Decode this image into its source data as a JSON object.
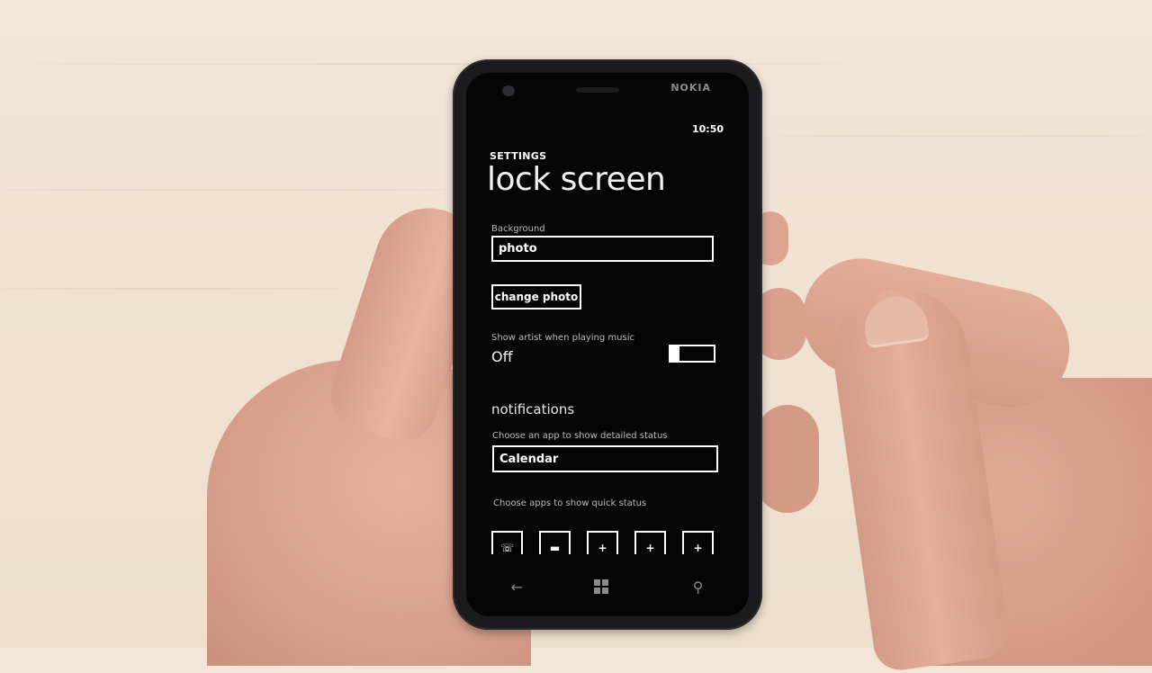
{
  "device": {
    "brand": "NOKIA",
    "status_bar": {
      "time": "10:50"
    }
  },
  "app": {
    "section_title": "SETTINGS",
    "page_title": "lock screen"
  },
  "background": {
    "label": "Background",
    "value": "photo",
    "change_button": "change photo"
  },
  "music_artist": {
    "label": "Show artist when playing music",
    "state": "Off",
    "enabled": false
  },
  "notifications": {
    "header": "notifications",
    "detailed_label": "Choose an app to show detailed status",
    "detailed_value": "Calendar",
    "quick_label": "Choose apps to show quick status",
    "quick_slots": [
      {
        "icon": "phone-icon",
        "glyph": "☏"
      },
      {
        "icon": "message-icon",
        "glyph": "▬"
      },
      {
        "icon": "add-icon",
        "glyph": "+"
      },
      {
        "icon": "add-icon",
        "glyph": "+"
      },
      {
        "icon": "add-icon",
        "glyph": "+"
      }
    ]
  },
  "navbar": {
    "back_glyph": "←",
    "search_glyph": "⚲"
  }
}
